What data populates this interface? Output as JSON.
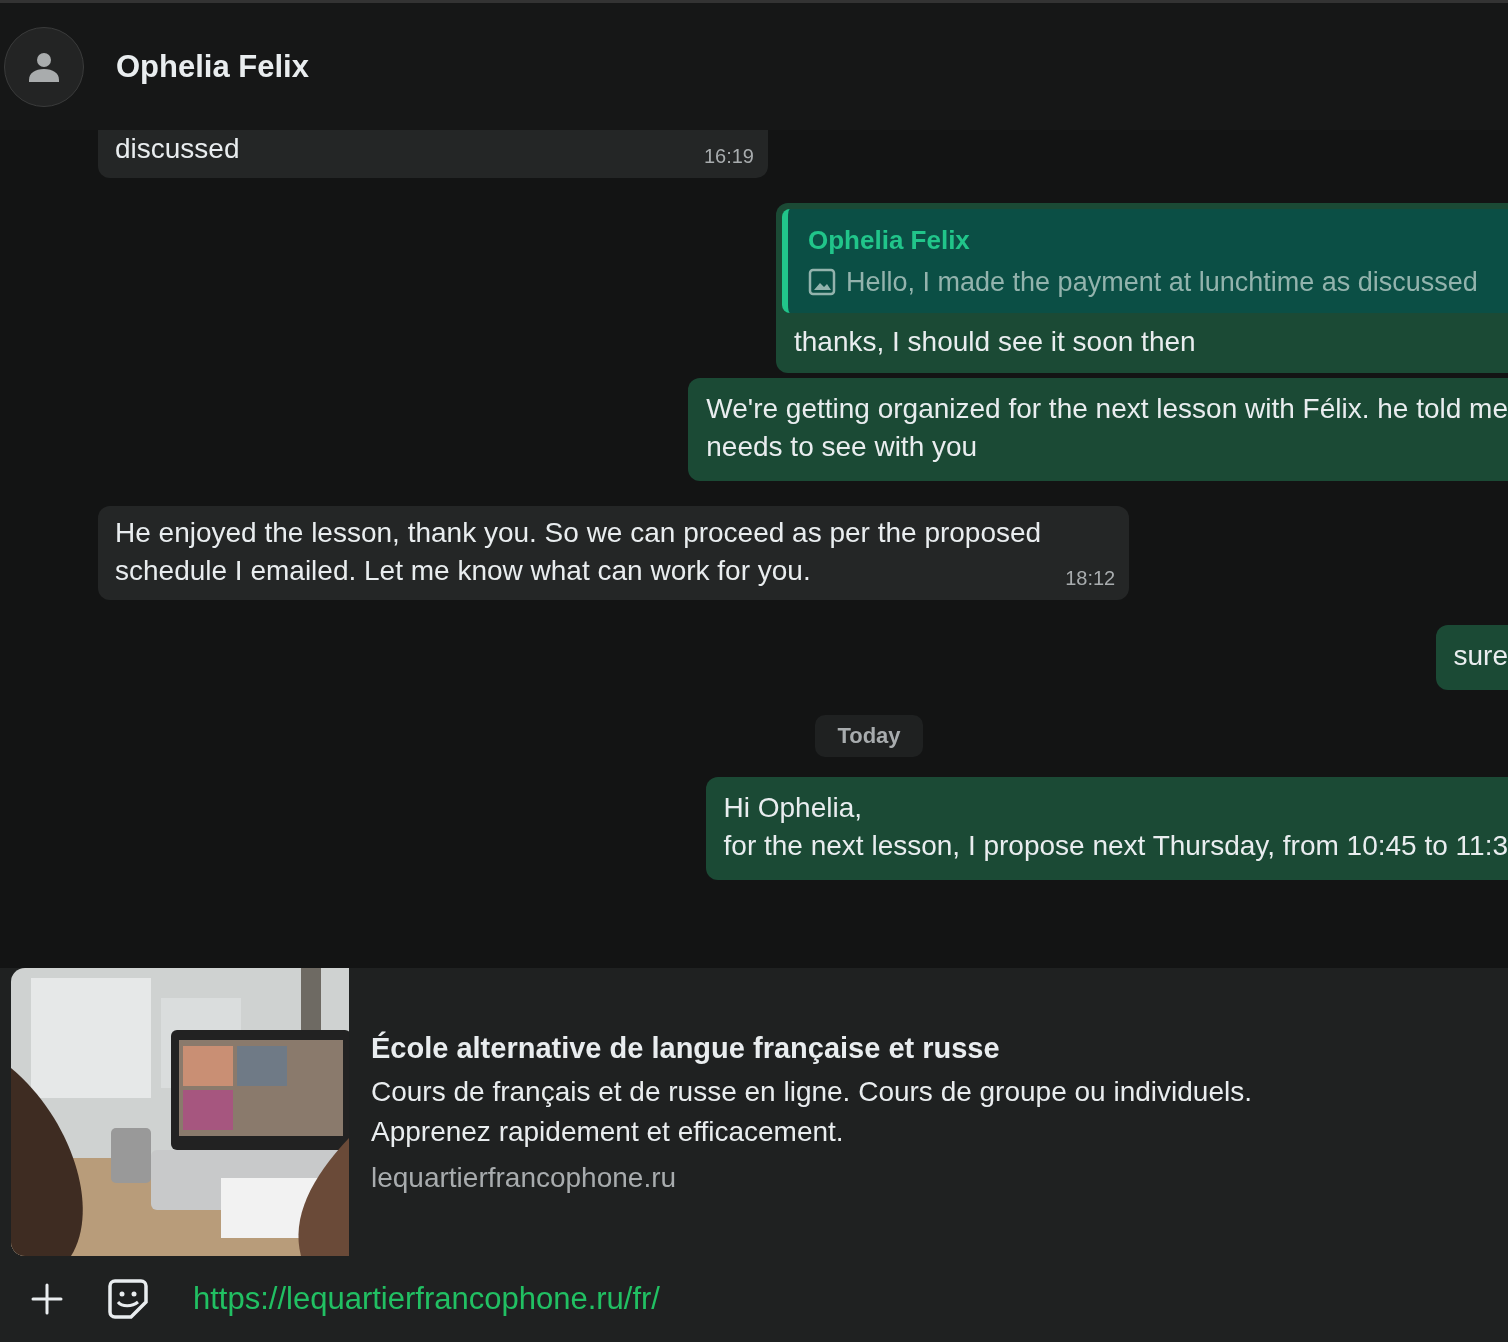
{
  "header": {
    "name": "Ophelia Felix"
  },
  "messages": [
    {
      "kind": "incoming",
      "text": "discussed",
      "time": "16:19",
      "cut_top": true
    },
    {
      "kind": "outgoing",
      "quote": {
        "author": "Ophelia Felix",
        "text": "Hello, I made the payment at lunchtime as discussed"
      },
      "text": "thanks, I should see it soon then"
    },
    {
      "kind": "outgoing",
      "text": "We're getting organized for the next lesson with Félix. he told me\nneeds to see with you"
    },
    {
      "kind": "incoming",
      "text": "He enjoyed the lesson, thank you. So we can proceed as per the proposed\nschedule I emailed. Let me know what can work for you.",
      "time": "18:12"
    },
    {
      "kind": "outgoing",
      "text": "sure"
    },
    {
      "kind": "date",
      "text": "Today"
    },
    {
      "kind": "outgoing",
      "text": "Hi Ophelia,\nfor the next lesson, I propose next Thursday, from 10:45 to 11:3"
    }
  ],
  "link_preview": {
    "title": "École alternative de langue française et russe",
    "description": "Cours de français et de russe en ligne. Cours de groupe ou individuels.\nApprenez rapidement et efficacement.",
    "domain": "lequartierfrancophone.ru"
  },
  "composer": {
    "value": "https://lequartierfrancophone.ru/fr/"
  }
}
